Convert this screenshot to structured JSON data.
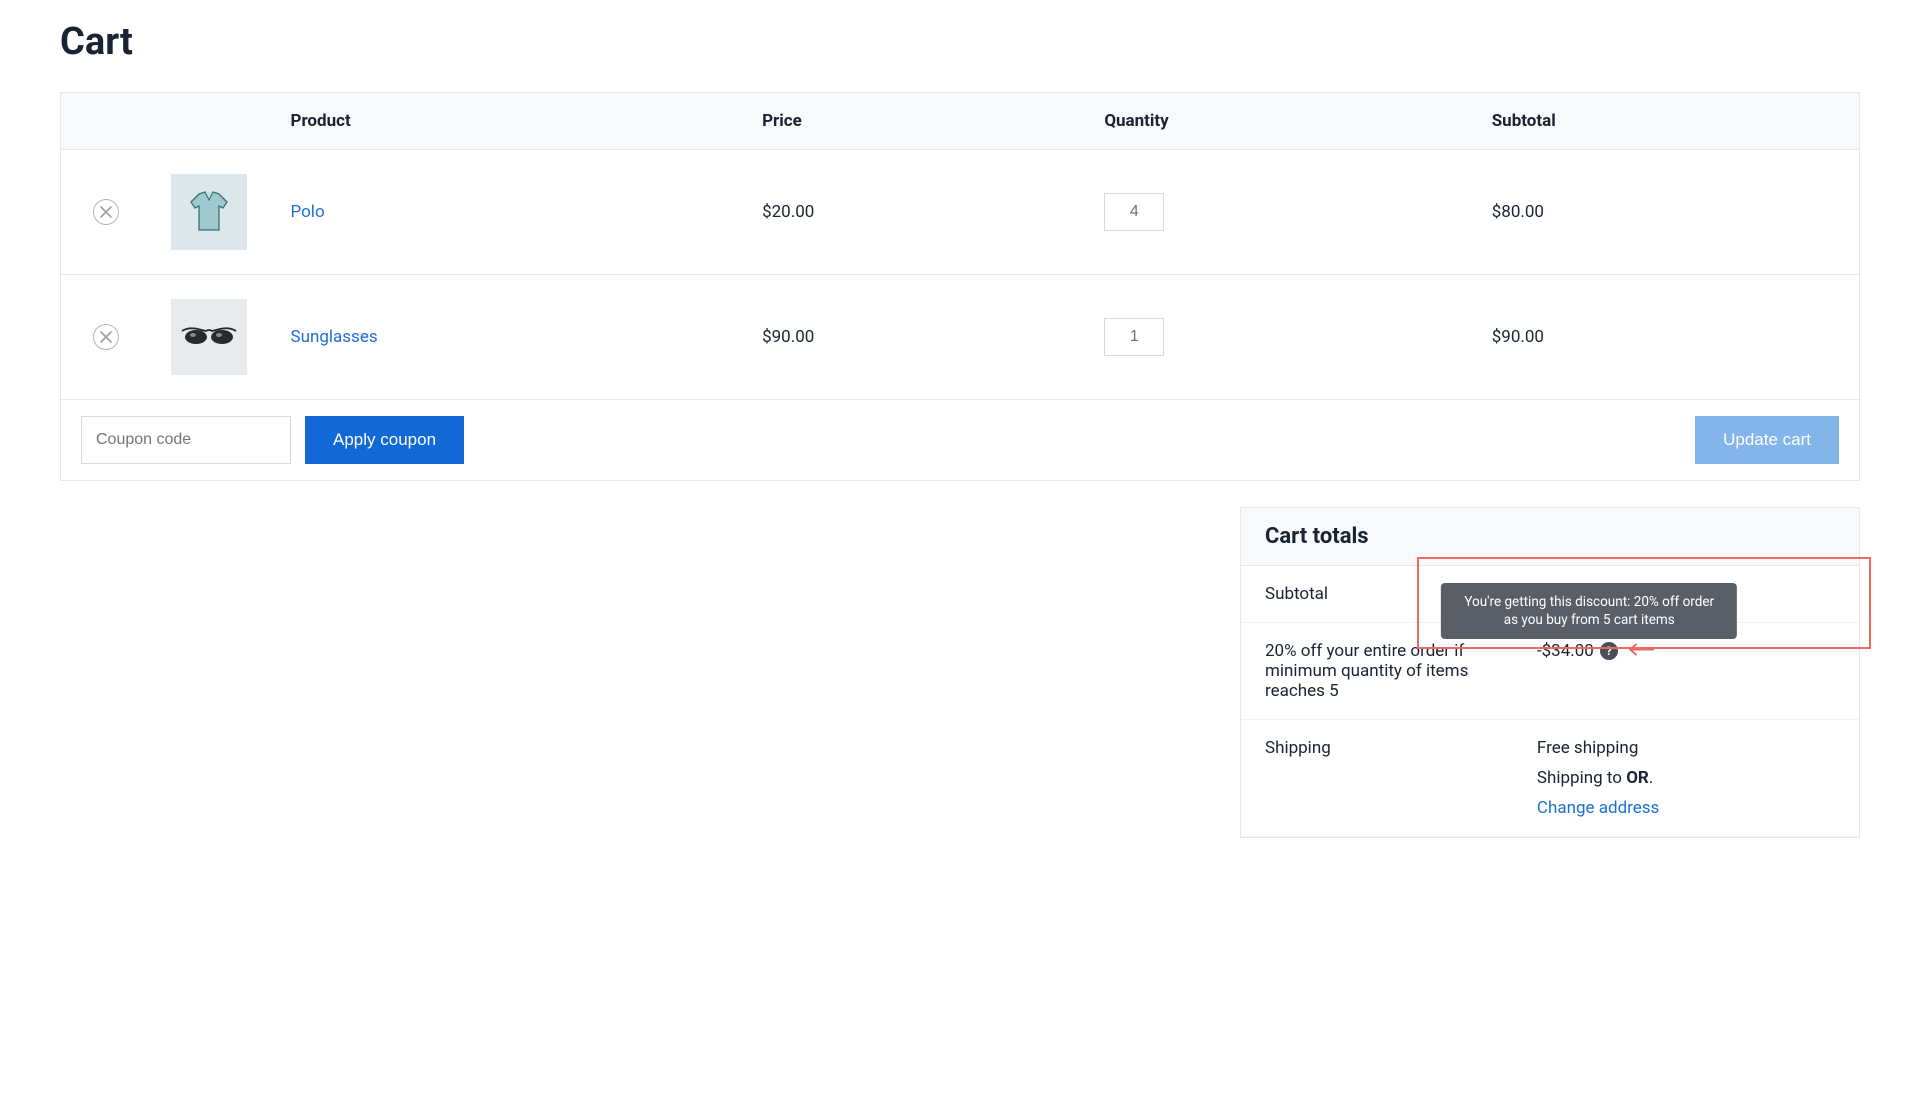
{
  "page": {
    "title": "Cart"
  },
  "table": {
    "headers": {
      "product": "Product",
      "price": "Price",
      "quantity": "Quantity",
      "subtotal": "Subtotal"
    }
  },
  "items": [
    {
      "name": "Polo",
      "price": "$20.00",
      "qty": "4",
      "subtotal": "$80.00",
      "thumb": "polo"
    },
    {
      "name": "Sunglasses",
      "price": "$90.00",
      "qty": "1",
      "subtotal": "$90.00",
      "thumb": "sunglasses"
    }
  ],
  "coupon": {
    "placeholder": "Coupon code",
    "apply_label": "Apply coupon"
  },
  "update_label": "Update cart",
  "totals": {
    "heading": "Cart totals",
    "subtotal_label": "Subtotal",
    "discount_label": "20% off your entire order if minimum quantity of items reaches 5",
    "discount_amount": "-$34.00",
    "tooltip_text": "You're getting this discount: 20% off order as you buy from 5 cart items",
    "shipping_label": "Shipping",
    "shipping_method": "Free shipping",
    "shipping_to_prefix": "Shipping to ",
    "shipping_to_region": "OR",
    "shipping_to_suffix": ".",
    "change_address": "Change address"
  },
  "icons": {
    "remove": "close-icon",
    "help": "?"
  }
}
